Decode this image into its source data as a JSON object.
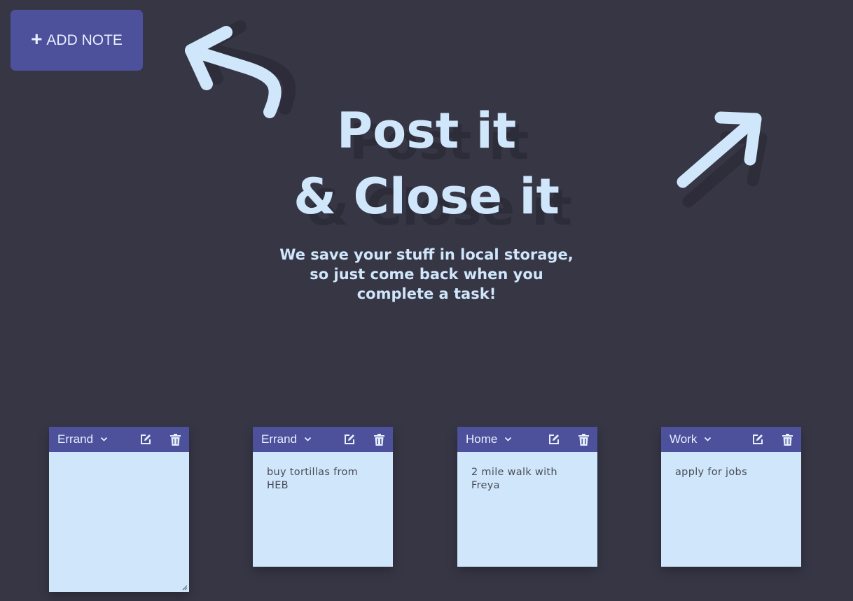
{
  "toolbar": {
    "add_note_label": "ADD NOTE",
    "add_icon": "+"
  },
  "hero": {
    "title_line1": "Post it",
    "title_line2": "& Close it",
    "subtitle": "We save your stuff in local storage, so just come back when you complete a task!"
  },
  "notes": [
    {
      "category": "Errand",
      "text": ""
    },
    {
      "category": "Errand",
      "text": "buy tortillas from HEB"
    },
    {
      "category": "Home",
      "text": "2 mile walk with Freya"
    },
    {
      "category": "Work",
      "text": "apply for jobs"
    }
  ],
  "icons": {
    "edit": "edit-icon",
    "delete": "trash-icon",
    "dropdown": "chevron-down-icon"
  },
  "colors": {
    "background": "#373645",
    "accent": "#4d509a",
    "note": "#d0e6fa",
    "text_light": "#cfe6fb"
  }
}
